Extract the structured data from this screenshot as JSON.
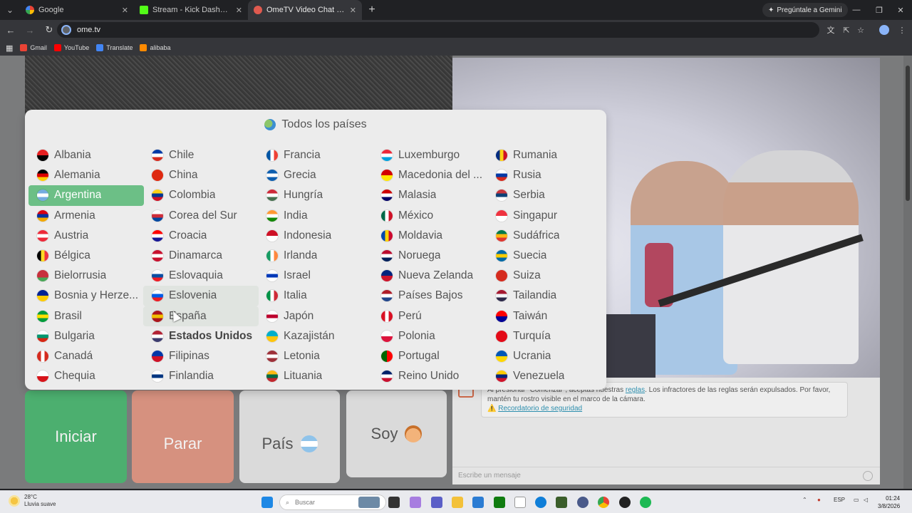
{
  "browser": {
    "tabs": [
      {
        "title": "Google",
        "active": false,
        "icon": "google-icon"
      },
      {
        "title": "Stream - Kick Dashboard",
        "active": false,
        "icon": "kick-icon"
      },
      {
        "title": "OmeTV Video Chat — Ome",
        "active": true,
        "icon": "ometv-icon"
      }
    ],
    "gemini_label": "Pregúntale a Gemini",
    "url": "ome.tv",
    "bookmarks": [
      "Gmail",
      "YouTube",
      "Translate",
      "alibaba"
    ]
  },
  "dropdown": {
    "title": "Todos los países",
    "columns": [
      [
        {
          "name": "Albania",
          "flag": [
            "#e41e20",
            "#000000"
          ]
        },
        {
          "name": "Alemania",
          "flag": [
            "#000000",
            "#dd0000",
            "#ffce00"
          ]
        },
        {
          "name": "Argentina",
          "flag": [
            "#74acdf",
            "#ffffff",
            "#74acdf"
          ],
          "selected": true
        },
        {
          "name": "Armenia",
          "flag": [
            "#d90012",
            "#0033a0",
            "#f2a800"
          ]
        },
        {
          "name": "Austria",
          "flag": [
            "#ed2939",
            "#ffffff",
            "#ed2939"
          ]
        },
        {
          "name": "Bélgica",
          "flag": [
            "#000000",
            "#fdda24",
            "#ef3340"
          ],
          "vertical": true
        },
        {
          "name": "Bielorrusia",
          "flag": [
            "#c8313e",
            "#c8313e",
            "#4aa657"
          ]
        },
        {
          "name": "Bosnia y Herze...",
          "flag": [
            "#002395",
            "#fecb00"
          ]
        },
        {
          "name": "Brasil",
          "flag": [
            "#009c3b",
            "#ffdf00",
            "#009c3b"
          ]
        },
        {
          "name": "Bulgaria",
          "flag": [
            "#ffffff",
            "#00966e",
            "#d62612"
          ]
        },
        {
          "name": "Canadá",
          "flag": [
            "#d52b1e",
            "#ffffff",
            "#d52b1e"
          ],
          "vertical": true
        },
        {
          "name": "Chequia",
          "flag": [
            "#ffffff",
            "#d7141a"
          ]
        }
      ],
      [
        {
          "name": "Chile",
          "flag": [
            "#0039a6",
            "#ffffff",
            "#d52b1e"
          ]
        },
        {
          "name": "China",
          "flag": [
            "#de2910",
            "#de2910"
          ]
        },
        {
          "name": "Colombia",
          "flag": [
            "#fcd116",
            "#003893",
            "#ce1126"
          ]
        },
        {
          "name": "Corea del Sur",
          "flag": [
            "#ffffff",
            "#cd2e3a",
            "#0047a0"
          ]
        },
        {
          "name": "Croacia",
          "flag": [
            "#ff0000",
            "#ffffff",
            "#171796"
          ]
        },
        {
          "name": "Dinamarca",
          "flag": [
            "#c8102e",
            "#ffffff",
            "#c8102e"
          ]
        },
        {
          "name": "Eslovaquia",
          "flag": [
            "#ffffff",
            "#0b4ea2",
            "#ee1c25"
          ]
        },
        {
          "name": "Eslovenia",
          "flag": [
            "#ffffff",
            "#005ce6",
            "#ed1c24"
          ],
          "hover": true
        },
        {
          "name": "España",
          "flag": [
            "#aa151b",
            "#f1bf00",
            "#aa151b"
          ],
          "hover": true
        },
        {
          "name": "Estados Unidos",
          "flag": [
            "#b22234",
            "#ffffff",
            "#3c3b6e"
          ],
          "bold": true
        },
        {
          "name": "Filipinas",
          "flag": [
            "#0038a8",
            "#ce1126"
          ]
        },
        {
          "name": "Finlandia",
          "flag": [
            "#ffffff",
            "#003580",
            "#ffffff"
          ]
        }
      ],
      [
        {
          "name": "Francia",
          "flag": [
            "#0055a4",
            "#ffffff",
            "#ef4135"
          ],
          "vertical": true
        },
        {
          "name": "Grecia",
          "flag": [
            "#0d5eaf",
            "#ffffff",
            "#0d5eaf"
          ]
        },
        {
          "name": "Hungría",
          "flag": [
            "#ce2939",
            "#ffffff",
            "#477050"
          ]
        },
        {
          "name": "India",
          "flag": [
            "#ff9933",
            "#ffffff",
            "#138808"
          ]
        },
        {
          "name": "Indonesia",
          "flag": [
            "#ce1126",
            "#ffffff"
          ]
        },
        {
          "name": "Irlanda",
          "flag": [
            "#169b62",
            "#ffffff",
            "#ff883e"
          ],
          "vertical": true
        },
        {
          "name": "Israel",
          "flag": [
            "#ffffff",
            "#0038b8",
            "#ffffff"
          ]
        },
        {
          "name": "Italia",
          "flag": [
            "#009246",
            "#ffffff",
            "#ce2b37"
          ],
          "vertical": true
        },
        {
          "name": "Japón",
          "flag": [
            "#ffffff",
            "#bc002d",
            "#ffffff"
          ]
        },
        {
          "name": "Kazajistán",
          "flag": [
            "#00afca",
            "#fec50c"
          ]
        },
        {
          "name": "Letonia",
          "flag": [
            "#9e3039",
            "#ffffff",
            "#9e3039"
          ]
        },
        {
          "name": "Lituania",
          "flag": [
            "#fdb913",
            "#006a44",
            "#c1272d"
          ]
        }
      ],
      [
        {
          "name": "Luxemburgo",
          "flag": [
            "#ed2939",
            "#ffffff",
            "#00a1de"
          ]
        },
        {
          "name": "Macedonia del ...",
          "flag": [
            "#d20000",
            "#ffe600"
          ]
        },
        {
          "name": "Malasia",
          "flag": [
            "#cc0001",
            "#ffffff",
            "#010066"
          ]
        },
        {
          "name": "México",
          "flag": [
            "#006847",
            "#ffffff",
            "#ce1126"
          ],
          "vertical": true
        },
        {
          "name": "Moldavia",
          "flag": [
            "#0046ae",
            "#ffd200",
            "#cc092f"
          ],
          "vertical": true
        },
        {
          "name": "Noruega",
          "flag": [
            "#ba0c2f",
            "#ffffff",
            "#00205b"
          ]
        },
        {
          "name": "Nueva Zelanda",
          "flag": [
            "#00247d",
            "#cc142b"
          ]
        },
        {
          "name": "Países Bajos",
          "flag": [
            "#ae1c28",
            "#ffffff",
            "#21468b"
          ]
        },
        {
          "name": "Perú",
          "flag": [
            "#d91023",
            "#ffffff",
            "#d91023"
          ],
          "vertical": true
        },
        {
          "name": "Polonia",
          "flag": [
            "#ffffff",
            "#dc143c"
          ]
        },
        {
          "name": "Portugal",
          "flag": [
            "#006600",
            "#ff0000"
          ],
          "vertical": true
        },
        {
          "name": "Reino Unido",
          "flag": [
            "#012169",
            "#ffffff",
            "#c8102e"
          ]
        }
      ],
      [
        {
          "name": "Rumania",
          "flag": [
            "#002b7f",
            "#fcd116",
            "#ce1126"
          ],
          "vertical": true
        },
        {
          "name": "Rusia",
          "flag": [
            "#ffffff",
            "#0039a6",
            "#d52b1e"
          ]
        },
        {
          "name": "Serbia",
          "flag": [
            "#c6363c",
            "#0c4076",
            "#ffffff"
          ]
        },
        {
          "name": "Singapur",
          "flag": [
            "#ef3340",
            "#ffffff"
          ]
        },
        {
          "name": "Sudáfrica",
          "flag": [
            "#007a4d",
            "#ffb612",
            "#de3831"
          ]
        },
        {
          "name": "Suecia",
          "flag": [
            "#006aa7",
            "#fecc00",
            "#006aa7"
          ]
        },
        {
          "name": "Suiza",
          "flag": [
            "#d52b1e",
            "#d52b1e"
          ]
        },
        {
          "name": "Tailandia",
          "flag": [
            "#a51931",
            "#f4f5f8",
            "#2d2a4a"
          ]
        },
        {
          "name": "Taiwán",
          "flag": [
            "#fe0000",
            "#000095"
          ]
        },
        {
          "name": "Turquía",
          "flag": [
            "#e30a17",
            "#e30a17"
          ]
        },
        {
          "name": "Ucrania",
          "flag": [
            "#0057b7",
            "#ffd700"
          ]
        },
        {
          "name": "Venezuela",
          "flag": [
            "#ffcc00",
            "#00247d",
            "#cf142b"
          ]
        }
      ]
    ]
  },
  "controls": {
    "start": "Iniciar",
    "stop": "Parar",
    "country": "País",
    "soy": "Soy"
  },
  "chat": {
    "rules_prefix": "Al presionar \"Comenzar\", aceptas nuestras",
    "rules_link": "reglas",
    "rules_suffix": ". Los infractores de las reglas serán expulsados. Por favor, mantén tu rostro visible en el marco de la cámara.",
    "safety_link": "Recordatorio de seguridad",
    "input_placeholder": "Escribe un mensaje"
  },
  "taskbar": {
    "temperature": "28°C",
    "weather": "Lluvia suave",
    "search_placeholder": "Buscar",
    "lang": "ESP",
    "time": "01:24",
    "date": "3/8/2026"
  }
}
